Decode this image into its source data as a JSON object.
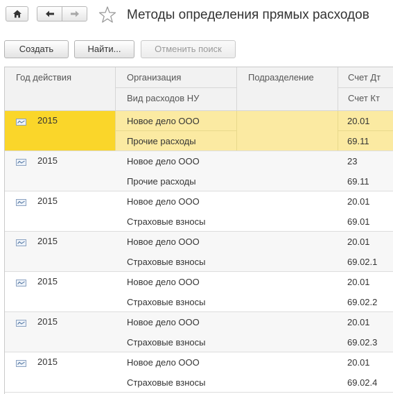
{
  "window": {
    "title": "Методы определения прямых расходов"
  },
  "toolbar": {
    "create_label": "Создать",
    "find_label": "Найти...",
    "cancel_search_label": "Отменить поиск"
  },
  "table": {
    "headers": {
      "year": "Год действия",
      "organization": "Организация",
      "expense_type": "Вид расходов НУ",
      "department": "Подразделение",
      "debit": "Счет Дт",
      "credit": "Счет Кт"
    },
    "rows": [
      {
        "year": "2015",
        "organization": "Новое дело ООО",
        "expense_type": "Прочие расходы",
        "department": "",
        "debit": "20.01",
        "credit": "69.11",
        "selected": true
      },
      {
        "year": "2015",
        "organization": "Новое дело ООО",
        "expense_type": "Прочие расходы",
        "department": "",
        "debit": "23",
        "credit": "69.11"
      },
      {
        "year": "2015",
        "organization": "Новое дело ООО",
        "expense_type": "Страховые взносы",
        "department": "",
        "debit": "20.01",
        "credit": "69.01"
      },
      {
        "year": "2015",
        "organization": "Новое дело ООО",
        "expense_type": "Страховые взносы",
        "department": "",
        "debit": "20.01",
        "credit": "69.02.1"
      },
      {
        "year": "2015",
        "organization": "Новое дело ООО",
        "expense_type": "Страховые взносы",
        "department": "",
        "debit": "20.01",
        "credit": "69.02.2"
      },
      {
        "year": "2015",
        "organization": "Новое дело ООО",
        "expense_type": "Страховые взносы",
        "department": "",
        "debit": "20.01",
        "credit": "69.02.3"
      },
      {
        "year": "2015",
        "organization": "Новое дело ООО",
        "expense_type": "Страховые взносы",
        "department": "",
        "debit": "20.01",
        "credit": "69.02.4"
      }
    ]
  },
  "icons": {
    "home": "home-icon",
    "back": "arrow-left-icon",
    "forward": "arrow-right-icon",
    "favorite": "star-icon",
    "row": "record-icon"
  },
  "colors": {
    "selected_row": "#fbeaa2",
    "selected_cell": "#fad62a"
  }
}
